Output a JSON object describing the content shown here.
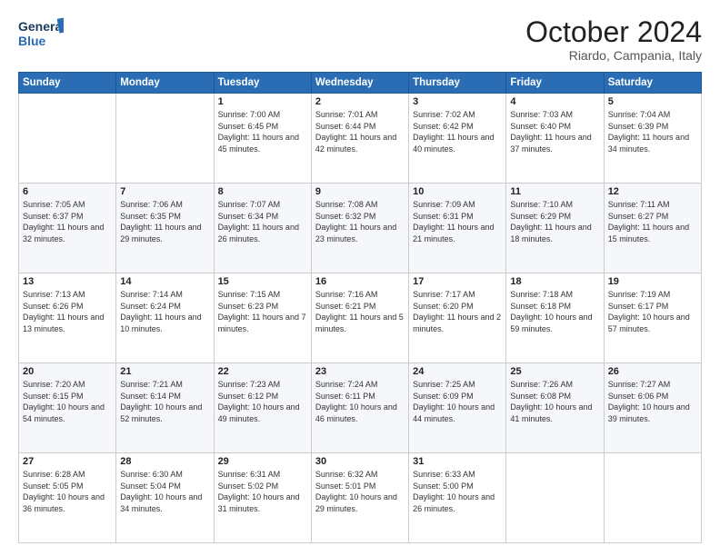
{
  "logo": {
    "line1": "General",
    "line2": "Blue"
  },
  "header": {
    "month": "October 2024",
    "location": "Riardo, Campania, Italy"
  },
  "weekdays": [
    "Sunday",
    "Monday",
    "Tuesday",
    "Wednesday",
    "Thursday",
    "Friday",
    "Saturday"
  ],
  "rows": [
    [
      {
        "day": "",
        "info": ""
      },
      {
        "day": "",
        "info": ""
      },
      {
        "day": "1",
        "info": "Sunrise: 7:00 AM\nSunset: 6:45 PM\nDaylight: 11 hours and 45 minutes."
      },
      {
        "day": "2",
        "info": "Sunrise: 7:01 AM\nSunset: 6:44 PM\nDaylight: 11 hours and 42 minutes."
      },
      {
        "day": "3",
        "info": "Sunrise: 7:02 AM\nSunset: 6:42 PM\nDaylight: 11 hours and 40 minutes."
      },
      {
        "day": "4",
        "info": "Sunrise: 7:03 AM\nSunset: 6:40 PM\nDaylight: 11 hours and 37 minutes."
      },
      {
        "day": "5",
        "info": "Sunrise: 7:04 AM\nSunset: 6:39 PM\nDaylight: 11 hours and 34 minutes."
      }
    ],
    [
      {
        "day": "6",
        "info": "Sunrise: 7:05 AM\nSunset: 6:37 PM\nDaylight: 11 hours and 32 minutes."
      },
      {
        "day": "7",
        "info": "Sunrise: 7:06 AM\nSunset: 6:35 PM\nDaylight: 11 hours and 29 minutes."
      },
      {
        "day": "8",
        "info": "Sunrise: 7:07 AM\nSunset: 6:34 PM\nDaylight: 11 hours and 26 minutes."
      },
      {
        "day": "9",
        "info": "Sunrise: 7:08 AM\nSunset: 6:32 PM\nDaylight: 11 hours and 23 minutes."
      },
      {
        "day": "10",
        "info": "Sunrise: 7:09 AM\nSunset: 6:31 PM\nDaylight: 11 hours and 21 minutes."
      },
      {
        "day": "11",
        "info": "Sunrise: 7:10 AM\nSunset: 6:29 PM\nDaylight: 11 hours and 18 minutes."
      },
      {
        "day": "12",
        "info": "Sunrise: 7:11 AM\nSunset: 6:27 PM\nDaylight: 11 hours and 15 minutes."
      }
    ],
    [
      {
        "day": "13",
        "info": "Sunrise: 7:13 AM\nSunset: 6:26 PM\nDaylight: 11 hours and 13 minutes."
      },
      {
        "day": "14",
        "info": "Sunrise: 7:14 AM\nSunset: 6:24 PM\nDaylight: 11 hours and 10 minutes."
      },
      {
        "day": "15",
        "info": "Sunrise: 7:15 AM\nSunset: 6:23 PM\nDaylight: 11 hours and 7 minutes."
      },
      {
        "day": "16",
        "info": "Sunrise: 7:16 AM\nSunset: 6:21 PM\nDaylight: 11 hours and 5 minutes."
      },
      {
        "day": "17",
        "info": "Sunrise: 7:17 AM\nSunset: 6:20 PM\nDaylight: 11 hours and 2 minutes."
      },
      {
        "day": "18",
        "info": "Sunrise: 7:18 AM\nSunset: 6:18 PM\nDaylight: 10 hours and 59 minutes."
      },
      {
        "day": "19",
        "info": "Sunrise: 7:19 AM\nSunset: 6:17 PM\nDaylight: 10 hours and 57 minutes."
      }
    ],
    [
      {
        "day": "20",
        "info": "Sunrise: 7:20 AM\nSunset: 6:15 PM\nDaylight: 10 hours and 54 minutes."
      },
      {
        "day": "21",
        "info": "Sunrise: 7:21 AM\nSunset: 6:14 PM\nDaylight: 10 hours and 52 minutes."
      },
      {
        "day": "22",
        "info": "Sunrise: 7:23 AM\nSunset: 6:12 PM\nDaylight: 10 hours and 49 minutes."
      },
      {
        "day": "23",
        "info": "Sunrise: 7:24 AM\nSunset: 6:11 PM\nDaylight: 10 hours and 46 minutes."
      },
      {
        "day": "24",
        "info": "Sunrise: 7:25 AM\nSunset: 6:09 PM\nDaylight: 10 hours and 44 minutes."
      },
      {
        "day": "25",
        "info": "Sunrise: 7:26 AM\nSunset: 6:08 PM\nDaylight: 10 hours and 41 minutes."
      },
      {
        "day": "26",
        "info": "Sunrise: 7:27 AM\nSunset: 6:06 PM\nDaylight: 10 hours and 39 minutes."
      }
    ],
    [
      {
        "day": "27",
        "info": "Sunrise: 6:28 AM\nSunset: 5:05 PM\nDaylight: 10 hours and 36 minutes."
      },
      {
        "day": "28",
        "info": "Sunrise: 6:30 AM\nSunset: 5:04 PM\nDaylight: 10 hours and 34 minutes."
      },
      {
        "day": "29",
        "info": "Sunrise: 6:31 AM\nSunset: 5:02 PM\nDaylight: 10 hours and 31 minutes."
      },
      {
        "day": "30",
        "info": "Sunrise: 6:32 AM\nSunset: 5:01 PM\nDaylight: 10 hours and 29 minutes."
      },
      {
        "day": "31",
        "info": "Sunrise: 6:33 AM\nSunset: 5:00 PM\nDaylight: 10 hours and 26 minutes."
      },
      {
        "day": "",
        "info": ""
      },
      {
        "day": "",
        "info": ""
      }
    ]
  ]
}
